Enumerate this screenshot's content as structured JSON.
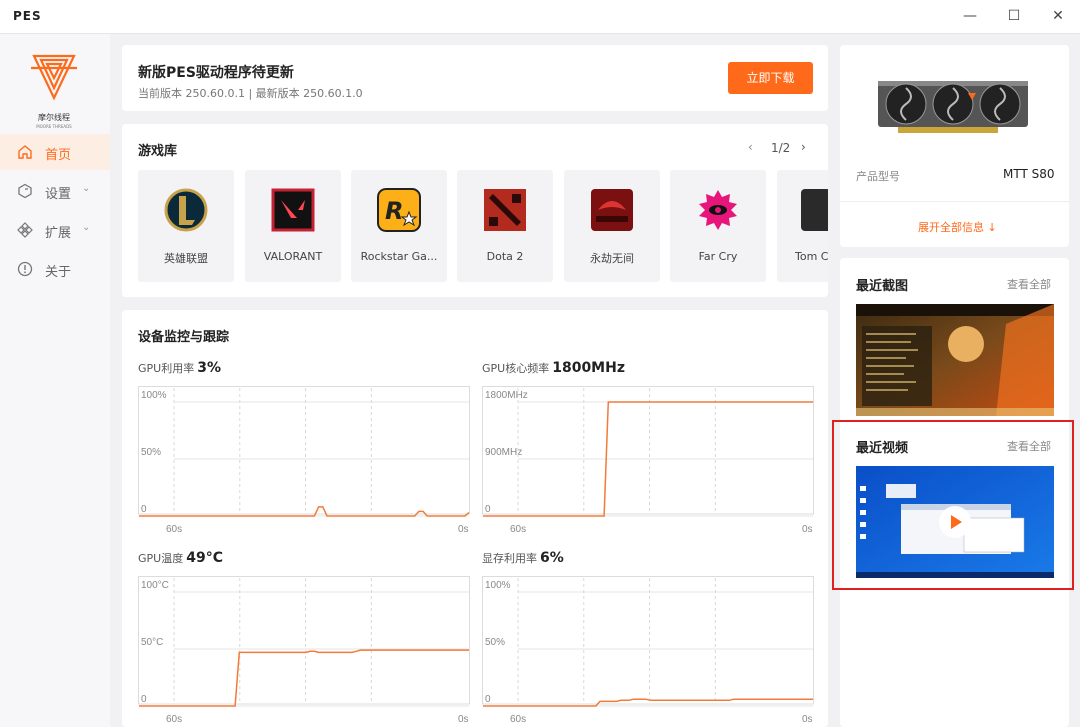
{
  "window": {
    "title": "PES"
  },
  "brand": {
    "logo_text": "摩尔线程",
    "logo_sub": "MOORE THREADS",
    "accent": "#ff6a1a"
  },
  "sidebar": {
    "items": [
      {
        "label": "首页",
        "icon": "home-icon",
        "active": true
      },
      {
        "label": "设置",
        "icon": "settings-icon",
        "active": false
      },
      {
        "label": "扩展",
        "icon": "extension-icon",
        "active": false
      },
      {
        "label": "关于",
        "icon": "info-icon",
        "active": false
      }
    ]
  },
  "update": {
    "title": "新版PES驱动程序待更新",
    "versions": "当前版本 250.60.0.1 | 最新版本 250.60.1.0",
    "button": "立即下载"
  },
  "library": {
    "title": "游戏库",
    "page": "1/2",
    "games": [
      {
        "name": "英雄联盟",
        "icon": "league-of-legends-icon"
      },
      {
        "name": "VALORANT",
        "icon": "valorant-icon"
      },
      {
        "name": "Rockstar Ga...",
        "icon": "rockstar-icon"
      },
      {
        "name": "Dota 2",
        "icon": "dota2-icon"
      },
      {
        "name": "永劫无间",
        "icon": "naraka-icon"
      },
      {
        "name": "Far Cry",
        "icon": "farcry-icon"
      },
      {
        "name": "Tom C",
        "icon": "tom-clancy-icon"
      }
    ]
  },
  "monitor": {
    "title": "设备监控与跟踪",
    "charts": [
      {
        "label": "GPU利用率",
        "value": "3%",
        "y_ticks": [
          "100%",
          "50%",
          "0"
        ],
        "x_ticks": [
          "60s",
          "0s"
        ],
        "y_max": 100,
        "series": [
          0,
          0,
          0,
          0,
          0,
          0,
          0,
          0,
          0,
          0,
          0,
          0,
          0,
          0,
          0,
          0,
          0,
          0,
          0,
          0,
          0,
          0,
          0,
          0,
          0,
          0,
          0,
          0,
          0,
          0,
          0,
          0,
          0,
          0,
          0,
          0,
          0,
          0,
          0,
          0,
          0,
          0,
          0,
          8,
          8,
          0,
          0,
          0,
          0,
          0,
          0,
          0,
          0,
          0,
          0,
          0,
          0,
          0,
          0,
          0,
          0,
          0,
          0,
          0,
          0,
          0,
          0,
          4,
          4,
          0,
          0,
          0,
          0,
          0,
          0,
          0,
          0,
          0,
          0,
          3
        ]
      },
      {
        "label": "GPU核心频率",
        "value": "1800MHz",
        "y_ticks": [
          "1800MHz",
          "900MHz",
          "0"
        ],
        "x_ticks": [
          "60s",
          "0s"
        ],
        "y_max": 1800,
        "series": [
          0,
          0,
          0,
          0,
          0,
          0,
          0,
          0,
          0,
          0,
          0,
          0,
          0,
          0,
          0,
          0,
          0,
          0,
          0,
          0,
          0,
          0,
          0,
          0,
          0,
          0,
          0,
          0,
          0,
          0,
          1800,
          1800,
          1800,
          1800,
          1800,
          1800,
          1800,
          1800,
          1800,
          1800,
          1800,
          1800,
          1800,
          1800,
          1800,
          1800,
          1800,
          1800,
          1800,
          1800,
          1800,
          1800,
          1800,
          1800,
          1800,
          1800,
          1800,
          1800,
          1800,
          1800,
          1800,
          1800,
          1800,
          1800,
          1800,
          1800,
          1800,
          1800,
          1800,
          1800,
          1800,
          1800,
          1800,
          1800,
          1800,
          1800,
          1800,
          1800,
          1800,
          1800
        ]
      },
      {
        "label": "GPU温度",
        "value": "49°C",
        "y_ticks": [
          "100°C",
          "50°C",
          "0"
        ],
        "x_ticks": [
          "60s",
          "0s"
        ],
        "y_max": 100,
        "series": [
          0,
          0,
          0,
          0,
          0,
          0,
          0,
          0,
          0,
          0,
          0,
          0,
          0,
          0,
          0,
          0,
          0,
          0,
          0,
          0,
          0,
          0,
          0,
          0,
          47,
          47,
          47,
          47,
          47,
          47,
          47,
          47,
          47,
          47,
          47,
          47,
          47,
          47,
          47,
          47,
          47,
          48,
          48,
          47,
          47,
          47,
          47,
          47,
          47,
          47,
          47,
          47,
          48,
          49,
          49,
          49,
          49,
          49,
          49,
          49,
          49,
          49,
          49,
          49,
          49,
          49,
          49,
          49,
          49,
          49,
          49,
          49,
          49,
          49,
          49,
          49,
          49,
          49,
          49,
          49
        ]
      },
      {
        "label": "显存利用率",
        "value": "6%",
        "y_ticks": [
          "100%",
          "50%",
          "0"
        ],
        "x_ticks": [
          "60s",
          "0s"
        ],
        "y_max": 100,
        "series": [
          0,
          0,
          0,
          0,
          0,
          0,
          0,
          0,
          0,
          0,
          0,
          0,
          0,
          0,
          0,
          0,
          0,
          0,
          0,
          0,
          0,
          0,
          0,
          0,
          0,
          0,
          0,
          0,
          4,
          4,
          4,
          4,
          4,
          5,
          5,
          5,
          6,
          6,
          6,
          6,
          5,
          5,
          5,
          5,
          5,
          5,
          5,
          5,
          5,
          5,
          5,
          5,
          5,
          5,
          5,
          5,
          5,
          5,
          5,
          5,
          6,
          6,
          6,
          6,
          6,
          6,
          6,
          6,
          6,
          6,
          6,
          6,
          6,
          6,
          6,
          6,
          6,
          6,
          6,
          6
        ]
      }
    ]
  },
  "product": {
    "model_label": "产品型号",
    "model_value": "MTT S80",
    "expand": "展开全部信息 ↓"
  },
  "screenshots": {
    "title": "最近截图",
    "link": "查看全部"
  },
  "videos": {
    "title": "最近视频",
    "link": "查看全部"
  }
}
